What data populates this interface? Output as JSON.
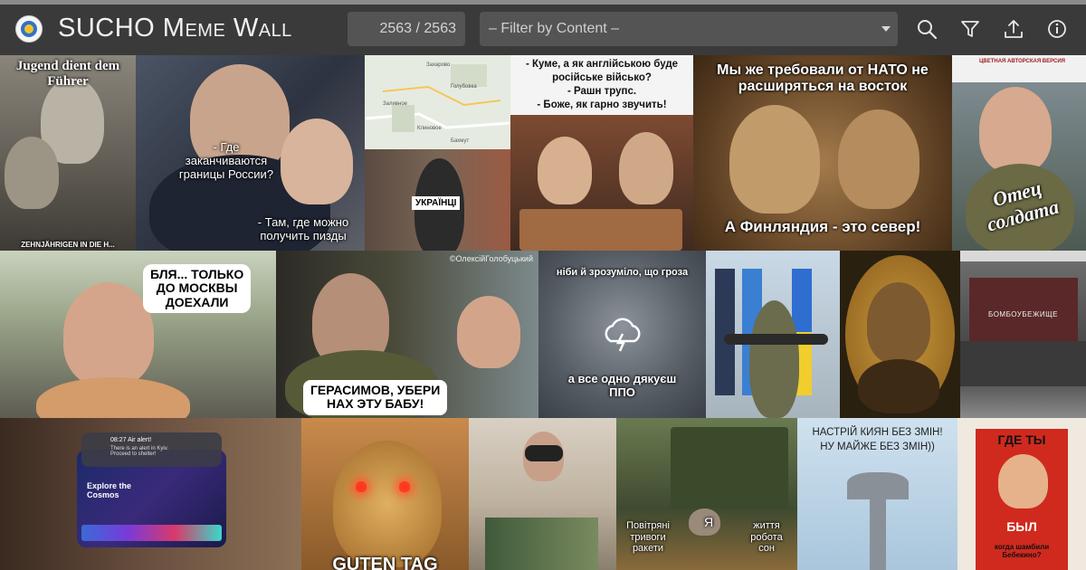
{
  "app": {
    "title_first": "SUCHO",
    "title_rest": "Meme Wall",
    "counter": "2563 / 2563",
    "filter_placeholder": "– Filter by Content –"
  },
  "toolbar": {
    "icons": [
      "search-icon",
      "filter-icon",
      "upload-icon",
      "info-icon"
    ]
  },
  "memes": {
    "m1": {
      "caption": "Jugend dient dem Führer",
      "bottom": "ZEHNJÄHRIGEN IN DIE H..."
    },
    "m2": {
      "q": "- Где\nзаканчиваются\nграницы России?",
      "a": "- Там, где можно\nполучить пизды"
    },
    "m3": {
      "map_labels": [
        "Захарово",
        "Голубовка",
        "Заливное",
        "Клиновое",
        "Бахмут"
      ]
    },
    "m4": {
      "label": "УКРАЇНЦІ"
    },
    "m5": {
      "text": "- Куме, а як англійською буде\nросійське військо?\n- Рашн трупс.\n- Боже, як гарно звучить!"
    },
    "m6": {
      "top": "Мы же требовали от НАТО не\nрасширяться на восток",
      "bottom": "А Финляндия - это север!"
    },
    "m7": {
      "corner": "ЦВЕТНАЯ АВТОРСКАЯ ВЕРСИЯ",
      "title": "Отец\nсолдата"
    },
    "m8": {
      "bubble": "БЛЯ... ТОЛЬКО\nДО МОСКВЫ\nДОЕХАЛИ"
    },
    "m9": {
      "credit": "©ОлексійГолобуцький",
      "bubble": "ГЕРАСИМОВ, УБЕРИ\nНАХ ЭТУ БАБУ!"
    },
    "m10": {
      "top": "ніби й зрозуміло, що гроза",
      "bottom": "а все одно дякуєш\nППО"
    },
    "m11": {},
    "m12": {},
    "m13": {
      "sign": "БОМБОУБЕЖИЩЕ"
    },
    "m14": {
      "alert_title": "08:27 Air alert!",
      "alert_body": "There is an alert in Kyiv.\nProceed to shelter!",
      "panel": "Explore the\nCosmos"
    },
    "m15": {
      "bottom": "GUTEN TAG"
    },
    "m16": {},
    "m17": {
      "left": "Повітряні\nтривоги\nракети",
      "mid": "Я",
      "right": "життя\nробота\nсон"
    },
    "m18": {
      "top": "НАСТРІЙ КИЯН БЕЗ ЗМІН!\nНУ МАЙЖЕ БЕЗ ЗМІН))"
    },
    "m19": {
      "top": "ГДЕ ТЫ",
      "mid": "БЫЛ",
      "bottom": "когда шамбили\nБебекино?"
    }
  }
}
